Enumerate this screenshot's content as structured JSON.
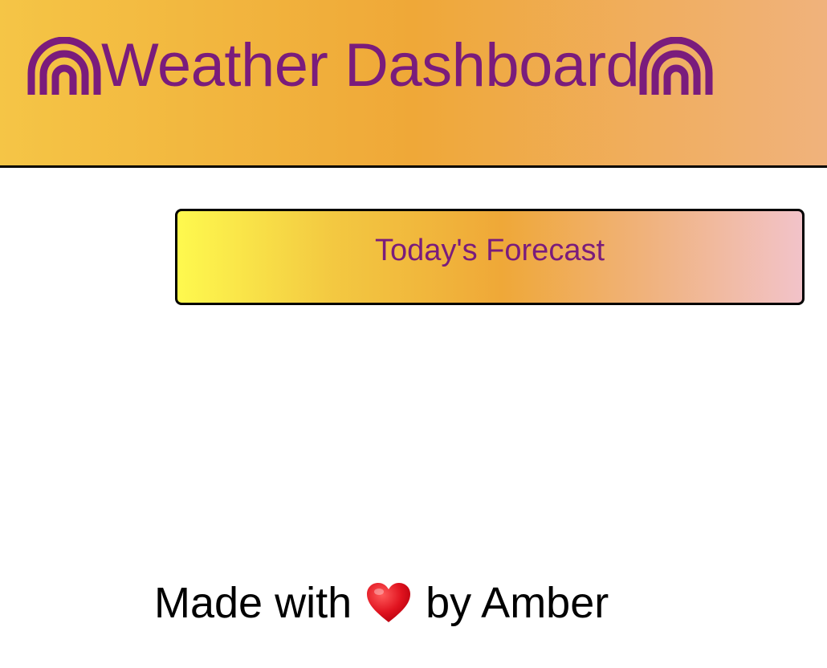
{
  "header": {
    "title": "Weather Dashboard",
    "left_icon": "rainbow-icon",
    "right_icon": "rainbow-icon"
  },
  "forecast": {
    "title": "Today's Forecast"
  },
  "footer": {
    "prefix": "Made with",
    "icon": "heart-icon",
    "suffix": "by Amber"
  },
  "colors": {
    "accent": "#7a1c7c",
    "header_gradient": [
      "#f5c546",
      "#efa838",
      "#f0b27c"
    ],
    "card_gradient": [
      "#fef94e",
      "#efa838",
      "#f2c3c9"
    ],
    "heart": "#e0131f"
  }
}
